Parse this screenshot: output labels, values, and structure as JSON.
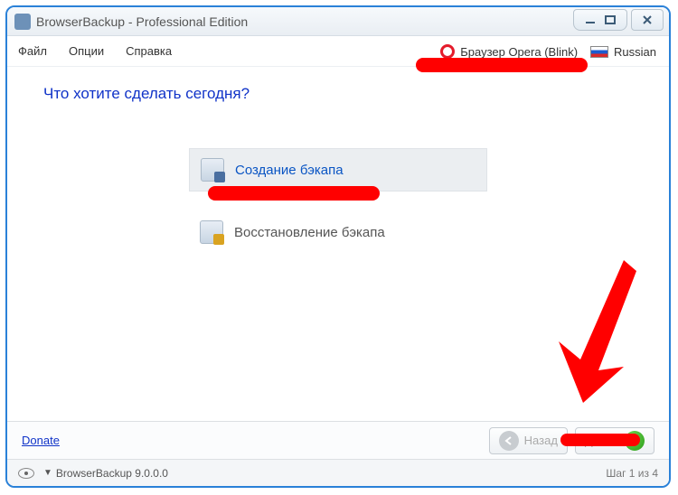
{
  "window": {
    "title": "BrowserBackup - Professional Edition"
  },
  "menu": {
    "file": "Файл",
    "options": "Опции",
    "help": "Справка"
  },
  "selectors": {
    "browser": "Браузер Opera (Blink)",
    "language": "Russian"
  },
  "heading": "Что хотите сделать сегодня?",
  "options": {
    "create": "Создание бэкапа",
    "restore": "Восстановление бэкапа"
  },
  "footer": {
    "donate": "Donate",
    "back": "Назад",
    "next": "Далее"
  },
  "status": {
    "product": "BrowserBackup 9.0.0.0",
    "step": "Шаг 1 из 4"
  }
}
